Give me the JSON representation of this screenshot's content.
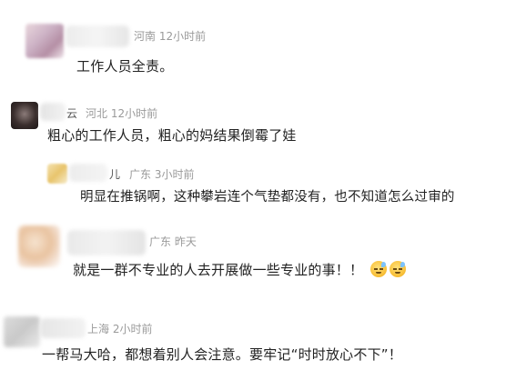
{
  "comments": [
    {
      "location": "河南",
      "time": "12小时前",
      "text": "工作人员全责。"
    },
    {
      "name_fragment": "云",
      "location": "河北",
      "time": "12小时前",
      "text": "粗心的工作人员，粗心的妈结果倒霉了娃"
    },
    {
      "name_fragment": "儿",
      "location": "广东",
      "time": "3小时前",
      "text": "明显在推锅啊，这种攀岩连个气垫都没有，也不知道怎么过审的"
    },
    {
      "location": "广东",
      "time": "昨天",
      "text": "就是一群不专业的人去开展做一些专业的事！！",
      "emoji": [
        "sweat-smile-icon",
        "sweat-smile-icon"
      ]
    },
    {
      "location": "上海",
      "time": "2小时前",
      "text": "一帮马大哈，都想着别人会注意。要牢记“时时放心不下”！"
    }
  ]
}
